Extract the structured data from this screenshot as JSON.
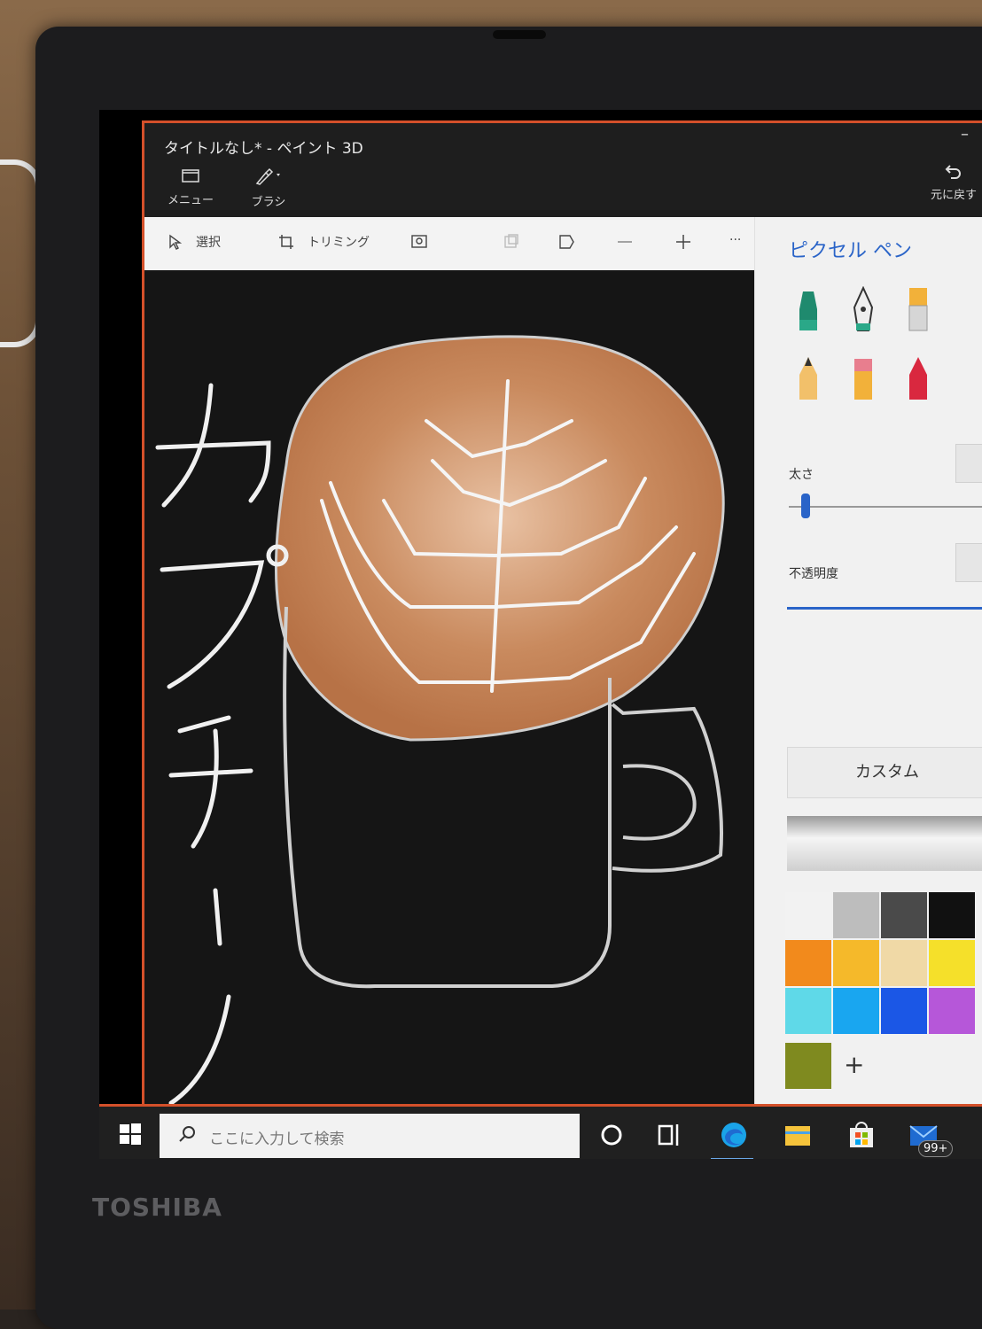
{
  "window": {
    "title": "タイトルなし* - ペイント 3D",
    "menu_label": "メニュー",
    "brush_label": "ブラシ",
    "undo_label": "元に戻す",
    "minimize_glyph": "–"
  },
  "toolbar": {
    "select_label": "選択",
    "trim_label": "トリミング",
    "more_glyph": "···"
  },
  "panel": {
    "title": "ピクセル ペン",
    "thickness_label": "太さ",
    "opacity_label": "不透明度",
    "custom_label": "カスタム",
    "add_color_glyph": "+"
  },
  "palette": {
    "rows": [
      [
        "#f2f2f2",
        "#bdbdbd",
        "#4a4a4a",
        "#111111"
      ],
      [
        "#f28a1c",
        "#f5b92a",
        "#f0d9a6",
        "#f5e02a"
      ],
      [
        "#5fd9e8",
        "#19a6f0",
        "#1b57e6",
        "#b657d9"
      ]
    ],
    "selected": "#7f8a1f"
  },
  "taskbar": {
    "search_placeholder": "ここに入力して検索",
    "mail_badge": "99+"
  },
  "device": {
    "brand": "TOSHIBA"
  },
  "colors": {
    "accent_orange": "#d4502a",
    "panel_blue": "#2a64c8",
    "coffee": "#c27a4e"
  },
  "drawing": {
    "text": "カプチーノ"
  }
}
